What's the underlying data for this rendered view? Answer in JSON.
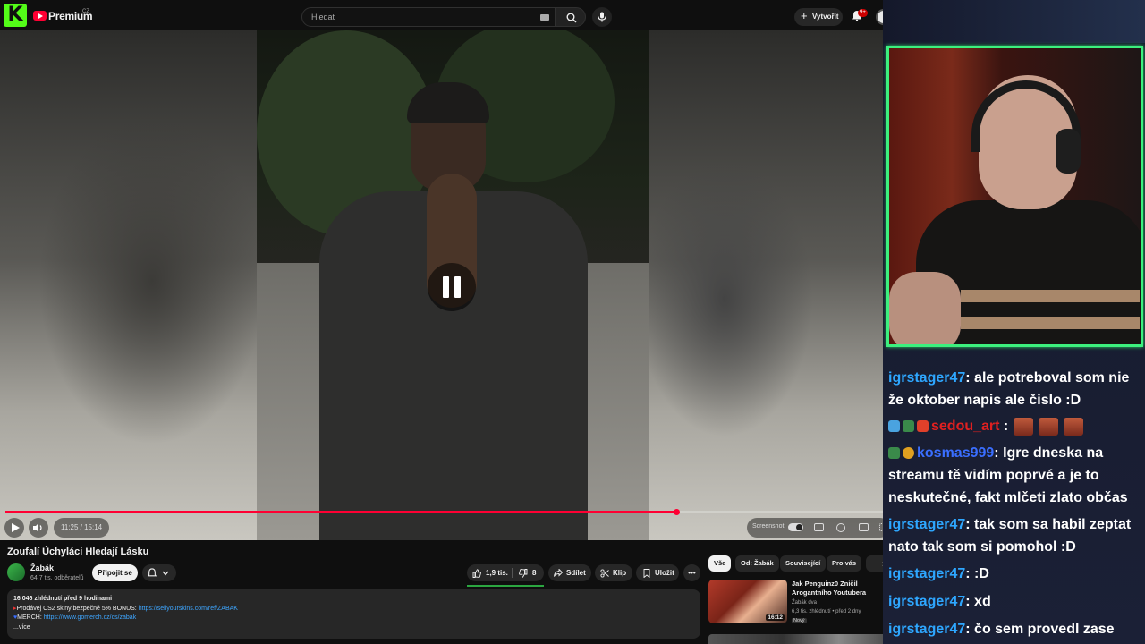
{
  "topbar": {
    "kick_logo": "K",
    "yt_name": "Premium",
    "yt_region": "CZ",
    "search_placeholder": "Hledat",
    "create_label": "Vytvořit",
    "notif_badge": "9+"
  },
  "player": {
    "time": "11:25 / 15:14",
    "progress": 0.759,
    "screenshot_label": "Screenshot"
  },
  "video": {
    "title": "Zoufalí Úchyláci Hledají Lásku",
    "channel": "Žabák",
    "subscribers": "64,7 tis. odběratelů",
    "join_label": "Připojit se",
    "likes": "1,9 tis.",
    "dislikes": "8",
    "share_label": "Sdílet",
    "clip_label": "Klip",
    "save_label": "Uložit",
    "more_label": "•••",
    "views_line": "16 046 zhlédnutí  před 9 hodinami",
    "desc_line1_prefix": "Prodávej CS2 skiny bezpečně 5% BONUS: ",
    "desc_line1_link": "https://sellyourskins.com/ref/ZABAK",
    "desc_line2_prefix": "MERCH: ",
    "desc_line2_link": "https://www.gomerch.cz/cs/zabak",
    "desc_more": "...více"
  },
  "sidebar": {
    "chips": [
      "Vše",
      "Od: Žabák",
      "Související",
      "Pro vás"
    ],
    "rec": {
      "title": "Jak Penguinz0 Zničil Arogantního Youtubera",
      "channel": "Žabák dva",
      "meta": "6,3 tis. zhlédnutí  •  před 2 dny",
      "badge": "Nový",
      "duration": "16:12"
    }
  },
  "chat": [
    {
      "user": "igrstager47",
      "text": ": ale potreboval som nie že oktober napis ale čislo :D"
    },
    {
      "user": "sedou_art",
      "text": " :"
    },
    {
      "user": "kosmas999",
      "text": ": Igre dneska na streamu tě vidím poprvé a je to neskutečné, fakt mlčeti zlato občas"
    },
    {
      "user": "igrstager47",
      "text": ": tak som sa habil zeptat nato tak som si pomohol :D"
    },
    {
      "user": "igrstager47",
      "text": ": :D"
    },
    {
      "user": "igrstager47",
      "text": ": xd"
    },
    {
      "user": "igrstager47",
      "text": ": čo sem provedl zase"
    }
  ],
  "colors": {
    "accent_red": "#ff0033",
    "kick_green": "#53fc18",
    "chat_user": "#2ea7ff",
    "cam_border": "#3cf07e"
  }
}
